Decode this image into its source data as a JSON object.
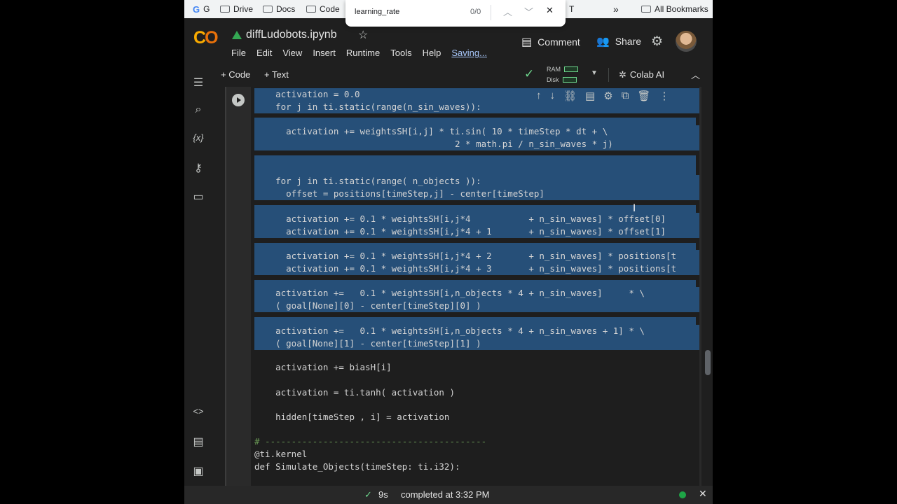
{
  "bookmarks": {
    "items": [
      {
        "label": "G"
      },
      {
        "label": "Drive"
      },
      {
        "label": "Docs"
      },
      {
        "label": "Code"
      },
      {
        "label": "T"
      }
    ],
    "overflow": "»",
    "all_bookmarks": "All Bookmarks"
  },
  "find_bar": {
    "query": "learning_rate",
    "count": "0/0"
  },
  "notebook": {
    "title": "diffLudobots.ipynb",
    "menu": [
      "File",
      "Edit",
      "View",
      "Insert",
      "Runtime",
      "Tools",
      "Help"
    ],
    "saving_label": "Saving..."
  },
  "header": {
    "comment_label": "Comment",
    "share_label": "Share"
  },
  "toolbar": {
    "add_code": "+ Code",
    "add_text": "+ Text",
    "ram_label": "RAM",
    "disk_label": "Disk",
    "colab_ai_label": "Colab AI"
  },
  "code_lines": [
    "    activation = 0.0",
    "    for j in ti.static(range(n_sin_waves)):",
    "",
    "      activation += weightsSH[i,j] * ti.sin( 10 * timeStep * dt + \\",
    "                                      2 * math.pi / n_sin_waves * j)",
    "",
    "",
    "    for j in ti.static(range( n_objects )):",
    "      offset = positions[timeStep,j] - center[timeStep]",
    "",
    "      activation += 0.1 * weightsSH[i,j*4           + n_sin_waves] * offset[0]",
    "      activation += 0.1 * weightsSH[i,j*4 + 1       + n_sin_waves] * offset[1]",
    "",
    "      activation += 0.1 * weightsSH[i,j*4 + 2       + n_sin_waves] * positions[t",
    "      activation += 0.1 * weightsSH[i,j*4 + 3       + n_sin_waves] * positions[t",
    "",
    "    activation +=   0.1 * weightsSH[i,n_objects * 4 + n_sin_waves]     * \\",
    "    ( goal[None][0] - center[timeStep][0] )",
    "",
    "    activation +=   0.1 * weightsSH[i,n_objects * 4 + n_sin_waves + 1] * \\",
    "    ( goal[None][1] - center[timeStep][1] )",
    "",
    "    activation += biasH[i]",
    "",
    "    activation = ti.tanh( activation )",
    "",
    "    hidden[timeStep , i] = activation",
    "",
    "# ------------------------------------------",
    "@ti.kernel",
    "def Simulate_Objects(timeStep: ti.i32):"
  ],
  "status": {
    "duration": "9s",
    "message": "completed at 3:32 PM"
  },
  "colors": {
    "accent_green": "#6dd58c",
    "selection": "#264f78",
    "background": "#1f1f1f"
  }
}
